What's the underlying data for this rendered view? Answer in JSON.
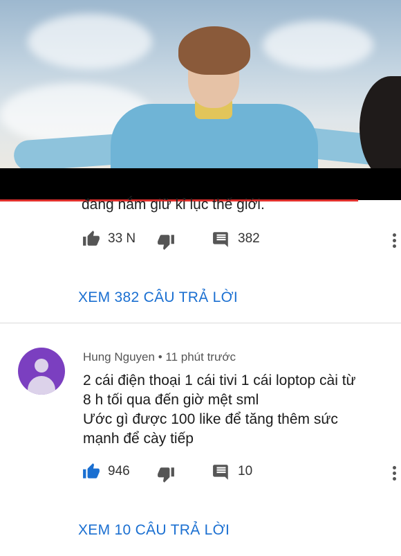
{
  "video": {
    "progress_fraction": 0.893
  },
  "top_comment": {
    "cut_text": "đang nắm giữ kỉ lục thế giới.",
    "likes": "33 N",
    "replies": "382",
    "view_replies": "XEM 382 CÂU TRẢ LỜI"
  },
  "comment": {
    "author": "Hung Nguyen",
    "separator": "•",
    "time": "11 phút trước",
    "lines": [
      "2 cái điện thoại 1 cái tivi 1 cái loptop cài từ",
      "8 h tối qua đến giờ mệt sml",
      "Ước gì được 100 like để tăng thêm sức",
      "mạnh để cày tiếp"
    ],
    "likes": "946",
    "replies": "10",
    "view_replies": "XEM 10 CÂU TRẢ LỜI"
  },
  "colors": {
    "link": "#1a6fd1",
    "progress": "#e0302d",
    "avatar": "#7b3fc0",
    "liked": "#1a6fd1"
  },
  "icons": {
    "like": "thumb-up-icon",
    "dislike": "thumb-down-icon",
    "reply": "comment-icon",
    "more": "more-vertical-icon"
  }
}
